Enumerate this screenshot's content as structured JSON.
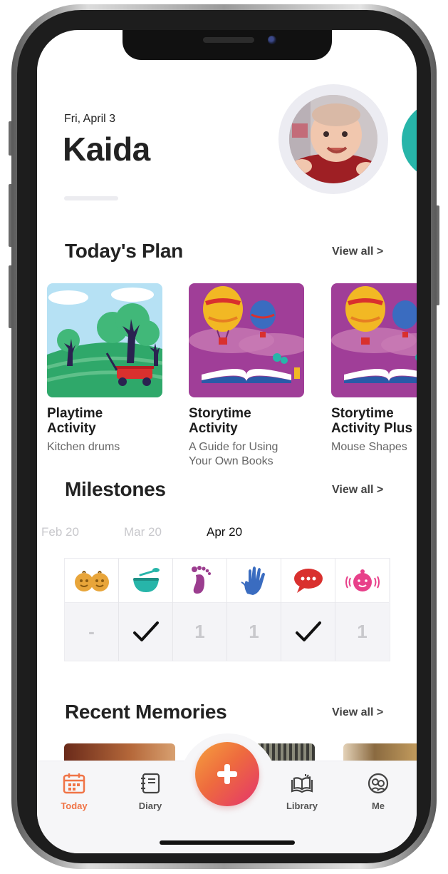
{
  "header": {
    "date": "Fri, April 3",
    "name": "Kaida"
  },
  "todays_plan": {
    "title": "Today's Plan",
    "view_all": "View all >",
    "cards": [
      {
        "title": "Playtime\nActivity",
        "subtitle": "Kitchen drums"
      },
      {
        "title": "Storytime\nActivity",
        "subtitle": "A Guide for Using\nYour Own Books"
      },
      {
        "title": "Storytime\nActivity Plus",
        "subtitle": "Mouse Shapes"
      }
    ]
  },
  "milestones": {
    "title": "Milestones",
    "view_all": "View all >",
    "months": [
      "Feb 20",
      "Mar 20",
      "Apr 20"
    ],
    "selected_month": "Apr 20",
    "columns": [
      {
        "icon": "social-faces-icon",
        "color": "#e8a53a",
        "value": "-"
      },
      {
        "icon": "feeding-bowl-icon",
        "color": "#27b5a9",
        "value": "✓"
      },
      {
        "icon": "footprint-icon",
        "color": "#9b3d8f",
        "value": "1"
      },
      {
        "icon": "hand-icon",
        "color": "#3a6cc0",
        "value": "1"
      },
      {
        "icon": "speech-bubble-icon",
        "color": "#d9302e",
        "value": "✓"
      },
      {
        "icon": "baby-babble-icon",
        "color": "#e8408a",
        "value": "1"
      }
    ]
  },
  "recent_memories": {
    "title": "Recent Memories",
    "view_all": "View all >"
  },
  "tabbar": {
    "tabs": [
      {
        "label": "Today",
        "icon": "calendar-icon",
        "active": true
      },
      {
        "label": "Diary",
        "icon": "diary-icon",
        "active": false
      },
      {
        "label": "Library",
        "icon": "library-book-icon",
        "active": false
      },
      {
        "label": "Me",
        "icon": "profile-icon",
        "active": false
      }
    ],
    "add_button_icon": "plus-icon"
  },
  "colors": {
    "accent": "#f07446",
    "teal": "#27b5a9",
    "text_dark": "#222222",
    "purple_card": "#a03e98"
  }
}
